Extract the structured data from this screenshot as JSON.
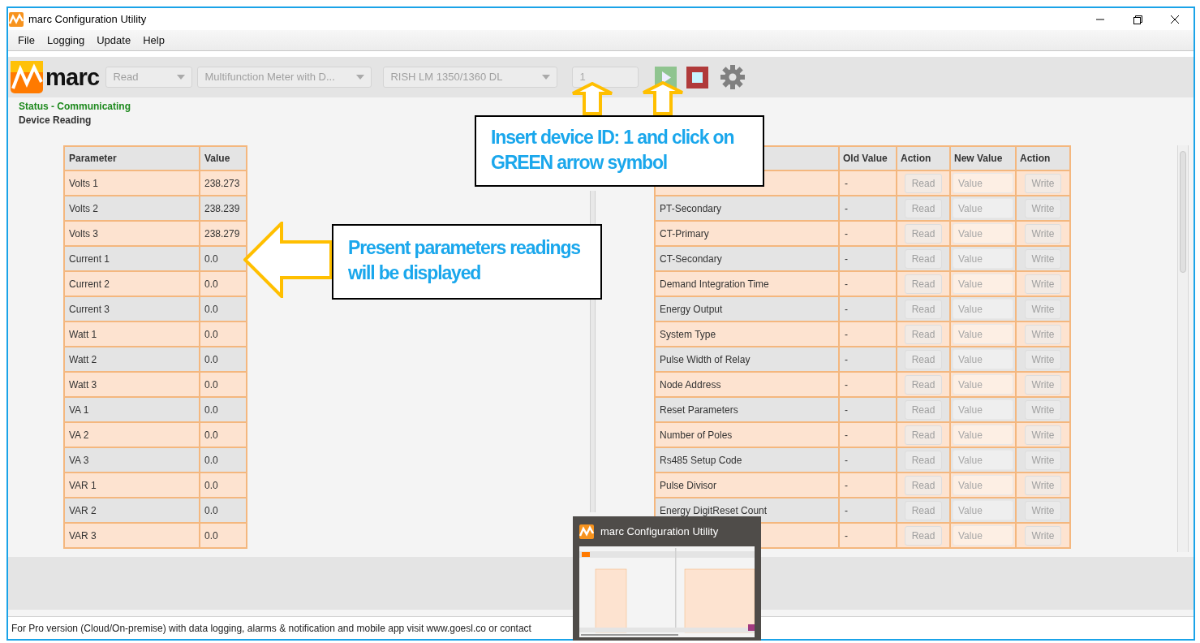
{
  "window": {
    "title": "marc Configuration Utility"
  },
  "menu": [
    "File",
    "Logging",
    "Update",
    "Help"
  ],
  "toolbar": {
    "logo_text": "marc",
    "selects": [
      {
        "value": "Read",
        "disabled": true
      },
      {
        "value": "Multifunction Meter with D...",
        "disabled": true
      },
      {
        "value": "RISH LM 1350/1360 DL",
        "disabled": true
      }
    ],
    "device_id": "1"
  },
  "status": "Status - Communicating",
  "section": "Device Reading",
  "readings": {
    "columns": [
      "Parameter",
      "Value"
    ],
    "rows": [
      {
        "parameter": "Volts 1",
        "value": "238.273"
      },
      {
        "parameter": "Volts 2",
        "value": "238.239"
      },
      {
        "parameter": "Volts 3",
        "value": "238.279"
      },
      {
        "parameter": "Current 1",
        "value": "0.0"
      },
      {
        "parameter": "Current 2",
        "value": "0.0"
      },
      {
        "parameter": "Current 3",
        "value": "0.0"
      },
      {
        "parameter": "Watt 1",
        "value": "0.0"
      },
      {
        "parameter": "Watt 2",
        "value": "0.0"
      },
      {
        "parameter": "Watt 3",
        "value": "0.0"
      },
      {
        "parameter": "VA 1",
        "value": "0.0"
      },
      {
        "parameter": "VA 2",
        "value": "0.0"
      },
      {
        "parameter": "VA 3",
        "value": "0.0"
      },
      {
        "parameter": "VAR 1",
        "value": "0.0"
      },
      {
        "parameter": "VAR 2",
        "value": "0.0"
      },
      {
        "parameter": "VAR 3",
        "value": "0.0"
      }
    ]
  },
  "settings": {
    "columns": [
      "Old Value",
      "Action",
      "New Value",
      "Action"
    ],
    "buttons_disabled": true,
    "rows": [
      {
        "old": "-",
        "read": "Read",
        "placeholder": "Value",
        "write": "Write"
      },
      {
        "parameter": "PT-Secondary",
        "old": "-",
        "read": "Read",
        "placeholder": "Value",
        "write": "Write"
      },
      {
        "parameter": "CT-Primary",
        "old": "-",
        "read": "Read",
        "placeholder": "Value",
        "write": "Write"
      },
      {
        "parameter": "CT-Secondary",
        "old": "-",
        "read": "Read",
        "placeholder": "Value",
        "write": "Write"
      },
      {
        "parameter": "Demand Integration Time",
        "old": "-",
        "read": "Read",
        "placeholder": "Value",
        "write": "Write"
      },
      {
        "parameter": "Energy Output",
        "old": "-",
        "read": "Read",
        "placeholder": "Value",
        "write": "Write"
      },
      {
        "parameter": "System Type",
        "old": "-",
        "read": "Read",
        "placeholder": "Value",
        "write": "Write"
      },
      {
        "parameter": "Pulse Width of Relay",
        "old": "-",
        "read": "Read",
        "placeholder": "Value",
        "write": "Write"
      },
      {
        "parameter": "Node Address",
        "old": "-",
        "read": "Read",
        "placeholder": "Value",
        "write": "Write"
      },
      {
        "parameter": "Reset Parameters",
        "old": "-",
        "read": "Read",
        "placeholder": "Value",
        "write": "Write"
      },
      {
        "parameter": "Number of Poles",
        "old": "-",
        "read": "Read",
        "placeholder": "Value",
        "write": "Write"
      },
      {
        "parameter": "Rs485 Setup Code",
        "old": "-",
        "read": "Read",
        "placeholder": "Value",
        "write": "Write"
      },
      {
        "parameter": "Pulse Divisor",
        "old": "-",
        "read": "Read",
        "placeholder": "Value",
        "write": "Write"
      },
      {
        "parameter": "Energy DigitReset Count",
        "old": "-",
        "read": "Read",
        "placeholder": "Value",
        "write": "Write"
      },
      {
        "old": "-",
        "read": "Read",
        "placeholder": "Value",
        "write": "Write"
      }
    ]
  },
  "footer": "For Pro version (Cloud/On-premise) with data logging, alarms & notification and mobile app visit www.goesl.co or contact",
  "callouts": [
    "Insert device ID: 1 and click on GREEN arrow symbol",
    "Present parameters readings will be displayed"
  ],
  "taskbar_preview": {
    "title": "marc Configuration Utility"
  }
}
